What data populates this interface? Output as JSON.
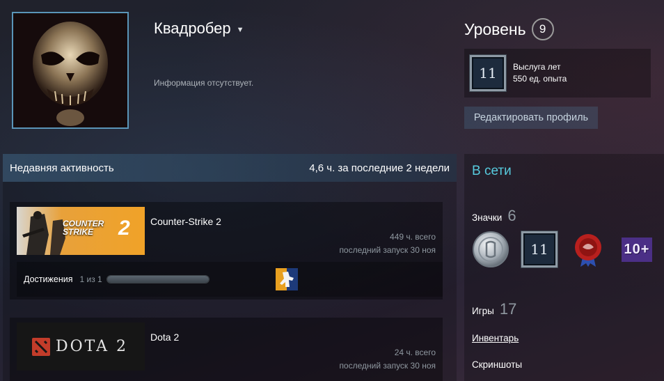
{
  "profile": {
    "name": "Квадробер",
    "summary": "Информация отсутствует."
  },
  "level": {
    "label": "Уровень",
    "value": "9"
  },
  "favorite_badge": {
    "icon_text": "11",
    "title": "Выслуга лет",
    "xp": "550 ед. опыта"
  },
  "edit_profile_label": "Редактировать профиль",
  "activity": {
    "title": "Недавняя активность",
    "hours": "4,6 ч. за последние 2 недели",
    "games": [
      {
        "name": "Counter-Strike 2",
        "hours": "449 ч. всего",
        "last_played": "последний запуск 30 ноя",
        "achievements_label": "Достижения",
        "achievements_count": "1 из 1",
        "achievements_progress": 1.0,
        "capsule_line1": "COUNTER",
        "capsule_line2": "STRIKE",
        "capsule_num": "2"
      },
      {
        "name": "Dota 2",
        "hours": "24 ч. всего",
        "last_played": "последний запуск 30 ноя",
        "capsule_text": "DOTA 2"
      }
    ]
  },
  "sidebar": {
    "status": "В сети",
    "badges_label": "Значки",
    "badges_count": "6",
    "badge_icons": [
      "coin-badge-icon",
      "years-of-service-icon",
      "wax-seal-badge-icon",
      "ten-plus-badge-icon"
    ],
    "years_badge_text": "11",
    "tenplus_text": "10+",
    "games_label": "Игры",
    "games_count": "17",
    "inventory_label": "Инвентарь",
    "screenshots_label": "Скриншоты"
  },
  "colors": {
    "accent_online": "#57cbde",
    "cs_capsule": "#f0a228"
  }
}
